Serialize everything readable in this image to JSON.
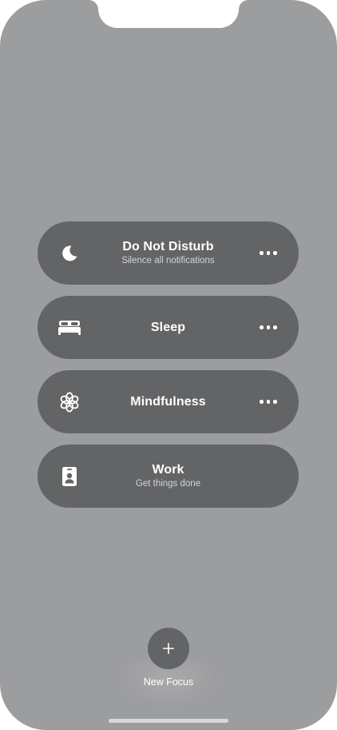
{
  "focus_modes": [
    {
      "title": "Do Not Disturb",
      "subtitle": "Silence all notifications",
      "icon": "moon-icon",
      "has_more": true
    },
    {
      "title": "Sleep",
      "subtitle": "",
      "icon": "bed-icon",
      "has_more": true
    },
    {
      "title": "Mindfulness",
      "subtitle": "",
      "icon": "flower-icon",
      "has_more": true
    },
    {
      "title": "Work",
      "subtitle": "Get things done",
      "icon": "id-badge-icon",
      "has_more": false
    }
  ],
  "new_focus": {
    "label": "New Focus",
    "icon": "plus-icon"
  },
  "colors": {
    "background": "#9c9d9f",
    "tile": "#626466",
    "text": "#ffffff",
    "subtext": "#d3d4d6"
  }
}
